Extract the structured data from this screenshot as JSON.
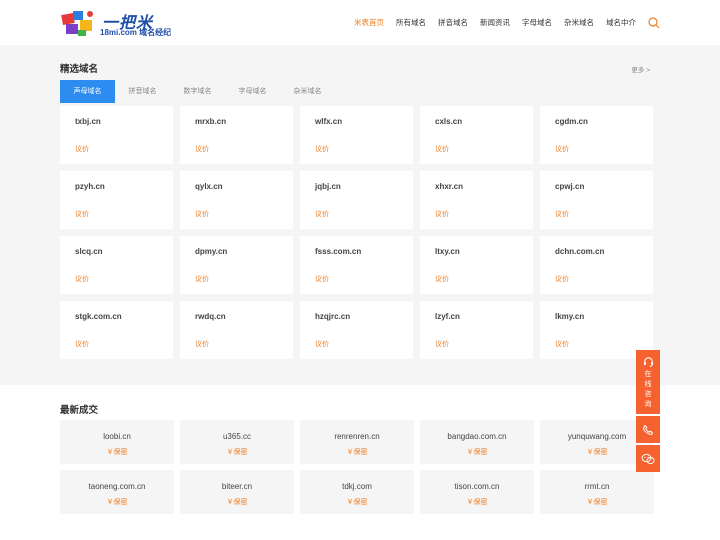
{
  "header": {
    "logo_title": "一把米",
    "logo_sub": "18mi.com 域名经纪",
    "nav": [
      "米表首页",
      "所有域名",
      "拼音域名",
      "新闻资讯",
      "字母域名",
      "杂米域名",
      "域名中介"
    ]
  },
  "featured": {
    "title": "精选域名",
    "more": "更多 >",
    "tabs": [
      "声母域名",
      "拼音域名",
      "数字域名",
      "字母域名",
      "杂米域名"
    ],
    "active_tab": 0,
    "price_label": "议价",
    "domains": [
      "txbj.cn",
      "mrxb.cn",
      "wlfx.cn",
      "cxls.cn",
      "cgdm.cn",
      "pzyh.cn",
      "qylx.cn",
      "jqbj.cn",
      "xhxr.cn",
      "cpwj.cn",
      "slcq.cn",
      "dpmy.cn",
      "fsss.com.cn",
      "ltxy.cn",
      "dchn.com.cn",
      "stgk.com.cn",
      "rwdq.cn",
      "hzqjrc.cn",
      "lzyf.cn",
      "lkmy.cn"
    ]
  },
  "recent": {
    "title": "最新成交",
    "price_label": "￥保密",
    "domains": [
      "loobi.cn",
      "u365.cc",
      "renrenren.cn",
      "bangdao.com.cn",
      "yunquwang.com",
      "taoneng.com.cn",
      "biteer.cn",
      "tdkj.com",
      "tison.com.cn",
      "rrmt.cn"
    ]
  },
  "float_bar": {
    "online_label": "在线咨询",
    "phone_icon": "phone-icon",
    "wechat_icon": "wechat-icon"
  },
  "colors": {
    "accent_orange": "#f07c1e",
    "tab_blue": "#2d8cf0",
    "float_orange": "#f5612f"
  }
}
